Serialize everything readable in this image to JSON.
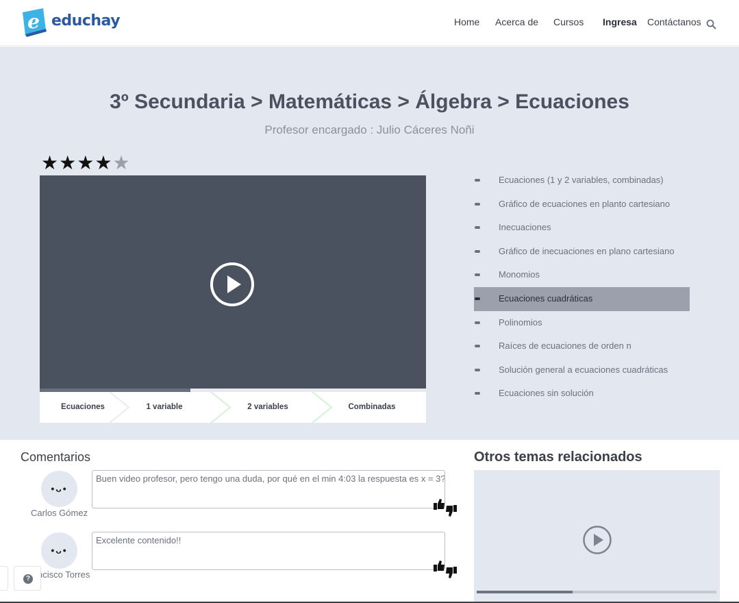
{
  "brand": {
    "name": "educhay",
    "logo_letter": "e",
    "color": "#2b5a9e",
    "badge_color": "#3cb2e6"
  },
  "nav": {
    "items": [
      {
        "label": "Home"
      },
      {
        "label": "Acerca de"
      },
      {
        "label": "Cursos"
      },
      {
        "label": "Ingresa"
      },
      {
        "label": "Contáctanos"
      }
    ],
    "search_icon": "search-icon"
  },
  "course": {
    "breadcrumb": "3º Secundaria > Matemáticas > Álgebra > Ecuaciones",
    "teacher": "Profesor encargado :  Julio Cáceres Noñi",
    "rating": {
      "value": 4,
      "max": 5,
      "filled_star": "★",
      "empty_star": "★"
    }
  },
  "video": {
    "progress": 0.39,
    "play_icon": "play-icon"
  },
  "steps": [
    {
      "label": "Ecuaciones"
    },
    {
      "label": "1 variable"
    },
    {
      "label": "2 variables"
    },
    {
      "label": "Combinadas"
    }
  ],
  "topics": [
    {
      "label": "Ecuaciones (1 y 2 variables, combinadas)",
      "active": false
    },
    {
      "label": "Gráfico de ecuaciones en planto cartesiano",
      "active": false
    },
    {
      "label": "Inecuaciones",
      "active": false
    },
    {
      "label": "Gráfico de inecuaciones en plano cartesiano",
      "active": false
    },
    {
      "label": "Monomios",
      "active": false
    },
    {
      "label": "Ecuaciones cuadráticas",
      "active": true
    },
    {
      "label": "Polinomios",
      "active": false
    },
    {
      "label": "Raíces de ecuaciones de orden n",
      "active": false
    },
    {
      "label": "Solución general a ecuaciones cuadráticas",
      "active": false
    },
    {
      "label": "Ecuaciones sin solución",
      "active": false
    }
  ],
  "comments": {
    "title": "Comentarios",
    "items": [
      {
        "author": "Carlos Gómez",
        "text": "Buen video profesor, pero tengo una duda, por qué en el min 4:03 la respuesta es x = 3?",
        "avatar_face": "•ᴗ•"
      },
      {
        "author": "ncisco Torres",
        "text": "Excelente contenido!!",
        "avatar_face": "•ᴗ•"
      }
    ]
  },
  "related": {
    "title": "Otros temas relacionados",
    "progress": 0.4
  },
  "help": {
    "label": "?"
  },
  "colors": {
    "hero_bg": "#e3e7ef",
    "video_bg": "#4a525f",
    "active_topic": "#9aa1ad"
  }
}
